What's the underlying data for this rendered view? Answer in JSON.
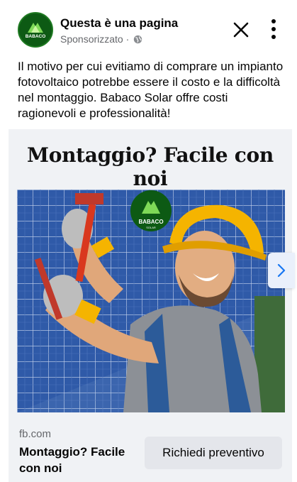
{
  "post": {
    "page_name": "Questa è una pagina",
    "sponsored_label": "Sponsorizzato",
    "separator": "·",
    "text": "Il motivo per cui evitiamo di comprare un impianto fotovoltaico potrebbe essere il costo e la difficoltà nel montaggio. Babaco Solar offre costi ragionevoli e professionalità!"
  },
  "ad": {
    "headline": "Montaggio? Facile con noi",
    "logo_text": "BABACO",
    "logo_subtext": "SOLAR"
  },
  "footer": {
    "domain": "fb.com",
    "title": "Montaggio? Facile con noi",
    "cta_label": "Richiedi preventivo"
  },
  "colors": {
    "brand_green": "#0d5a14",
    "helmet_yellow": "#f5b400",
    "panel_blue": "#2f5aa8"
  },
  "icons": [
    "babaco-logo-icon",
    "globe-icon",
    "close-icon",
    "more-vertical-icon",
    "chevron-right-icon"
  ]
}
